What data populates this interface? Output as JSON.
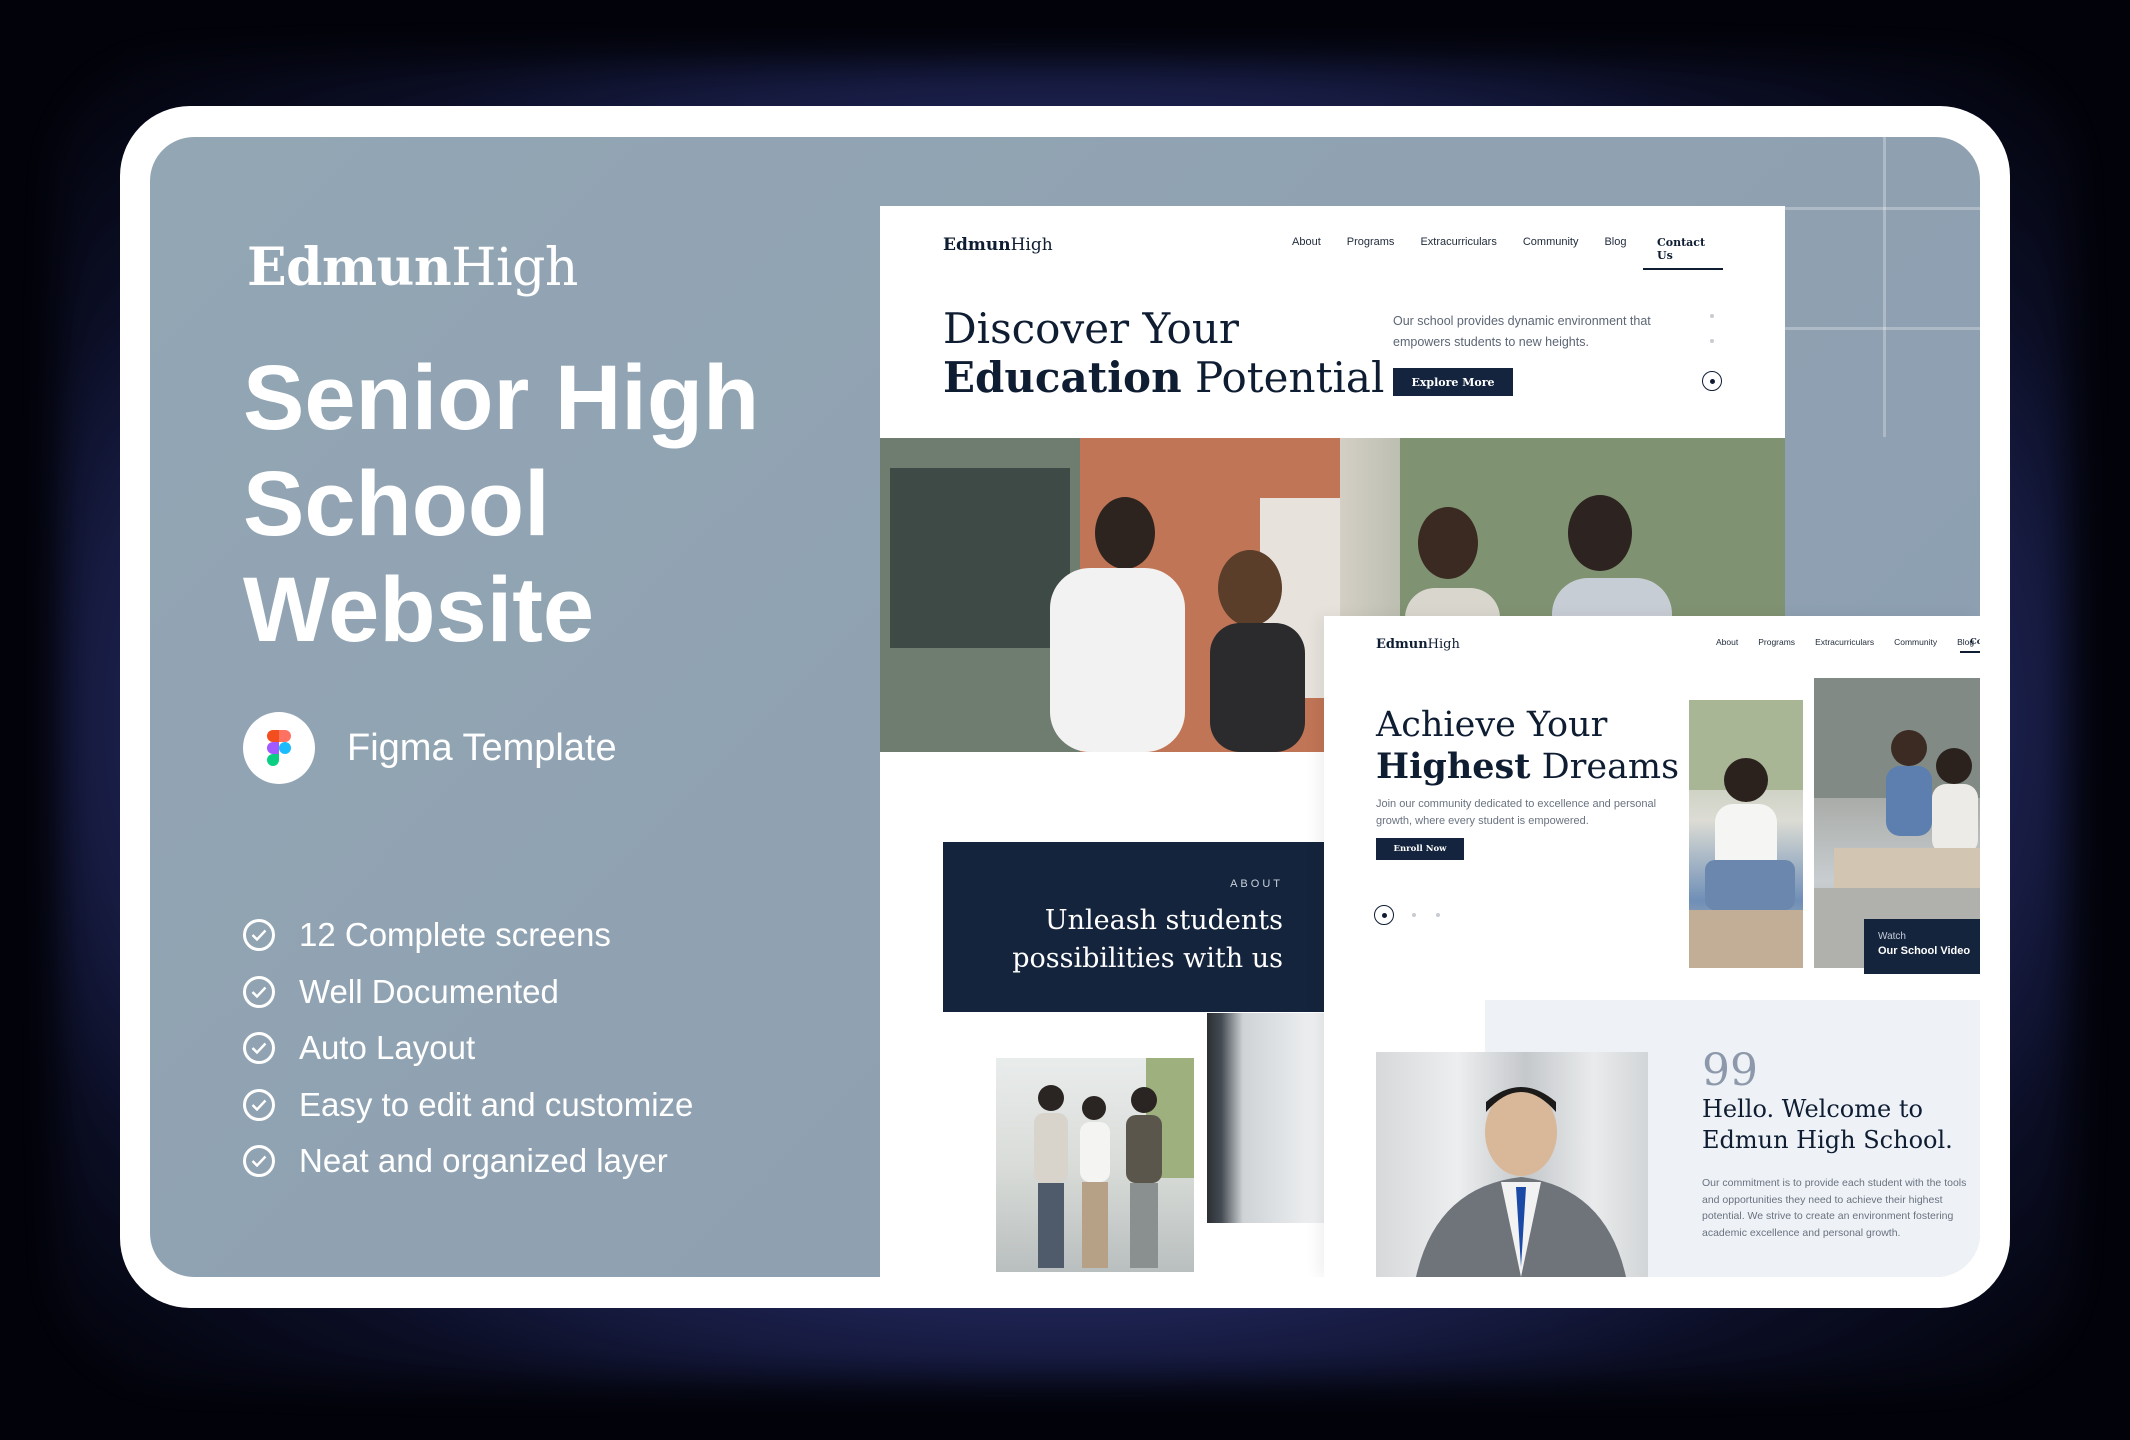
{
  "brand": {
    "bold": "Edmun",
    "light": "High"
  },
  "headline": "Senior High School Website",
  "figma": {
    "icon": "figma-icon",
    "label": "Figma Template"
  },
  "features": [
    "12 Complete screens",
    "Well Documented",
    "Auto Layout",
    "Easy to edit and customize",
    "Neat and organized layer"
  ],
  "screen1": {
    "logo": {
      "bold": "Edmun",
      "light": "High"
    },
    "nav": [
      "About",
      "Programs",
      "Extracurriculars",
      "Community",
      "Blog"
    ],
    "contact": "Contact Us",
    "hero": {
      "line1": "Discover Your",
      "bold": "Education",
      "rest": " Potential",
      "description": "Our school provides dynamic environment that empowers students to new heights.",
      "button": "Explore More"
    },
    "about": {
      "kicker": "ABOUT",
      "title": "Unleash students possibilities with us"
    }
  },
  "screen2": {
    "logo": {
      "bold": "Edmun",
      "light": "High"
    },
    "nav": [
      "About",
      "Programs",
      "Extracurriculars",
      "Community",
      "Blog"
    ],
    "contact": "Co",
    "hero": {
      "line1": "Achieve Your",
      "bold": "Highest",
      "rest": " Dreams",
      "description": "Join our community dedicated to excellence and personal growth, where every student is empowered.",
      "button": "Enroll Now"
    },
    "video": {
      "small": "Watch",
      "big": "Our School Video"
    },
    "welcome": {
      "quote": "99",
      "title": "Hello. Welcome to Edmun High School.",
      "description": "Our commitment is to provide each student with the tools and opportunities they need to achieve their highest potential. We strive to create an environment fostering academic excellence and personal growth."
    }
  },
  "colors": {
    "panel": "#93a6b4",
    "navy": "#14243f",
    "frame": "#ffffff"
  }
}
